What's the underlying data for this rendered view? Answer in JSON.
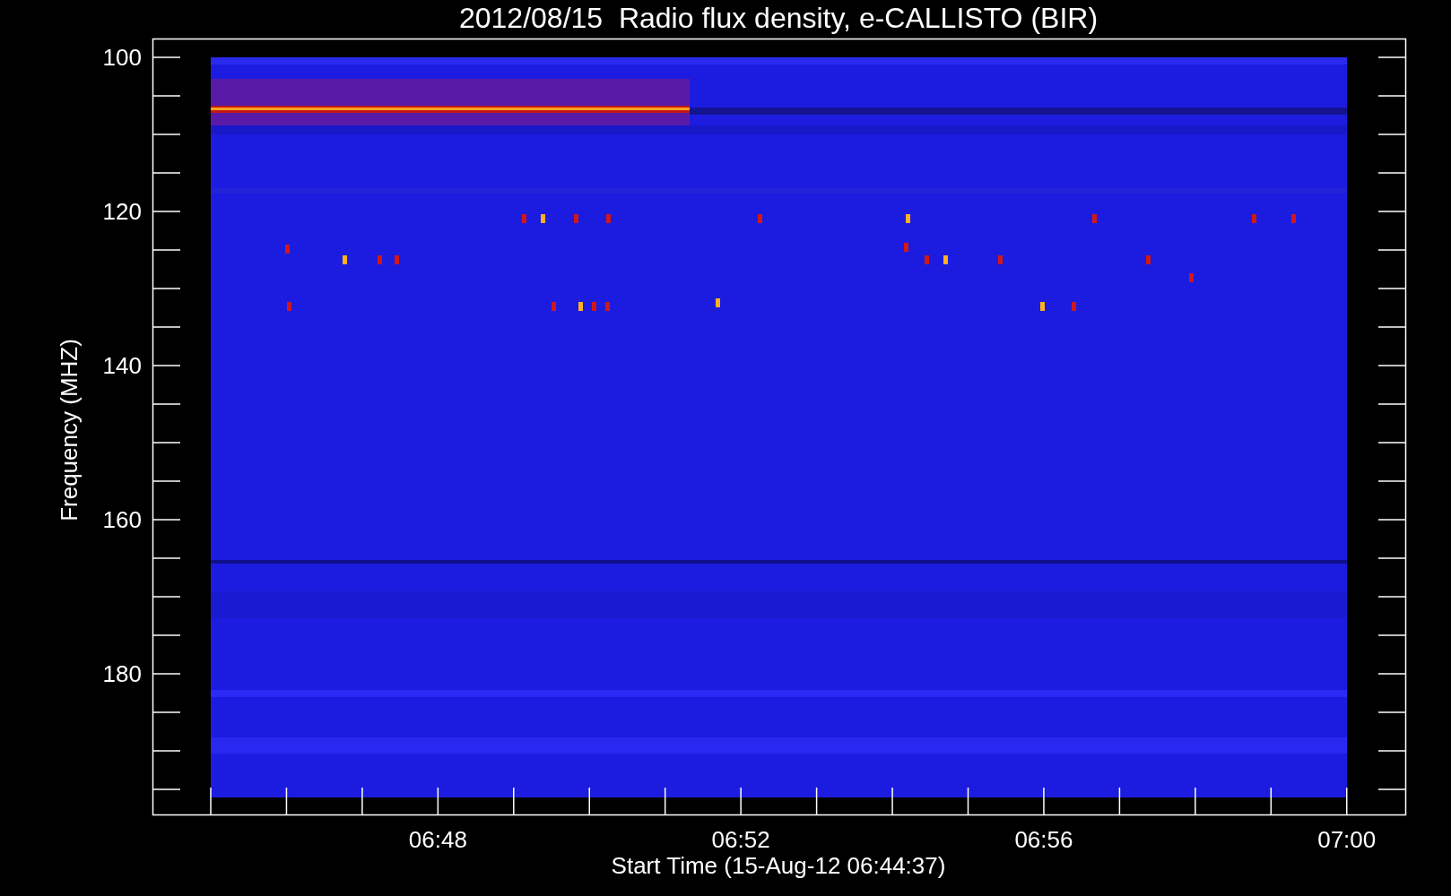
{
  "plot": {
    "title": "2012/08/15  Radio flux density, e-CALLISTO (BIR)",
    "y_axis": {
      "label": "Frequency (MHZ)",
      "tick_labels": [
        "100",
        "120",
        "140",
        "160",
        "180"
      ]
    },
    "x_axis": {
      "label": "Start Time (15-Aug-12 06:44:37)",
      "tick_labels": [
        "06:48",
        "06:52",
        "06:56",
        "07:00"
      ]
    }
  }
}
